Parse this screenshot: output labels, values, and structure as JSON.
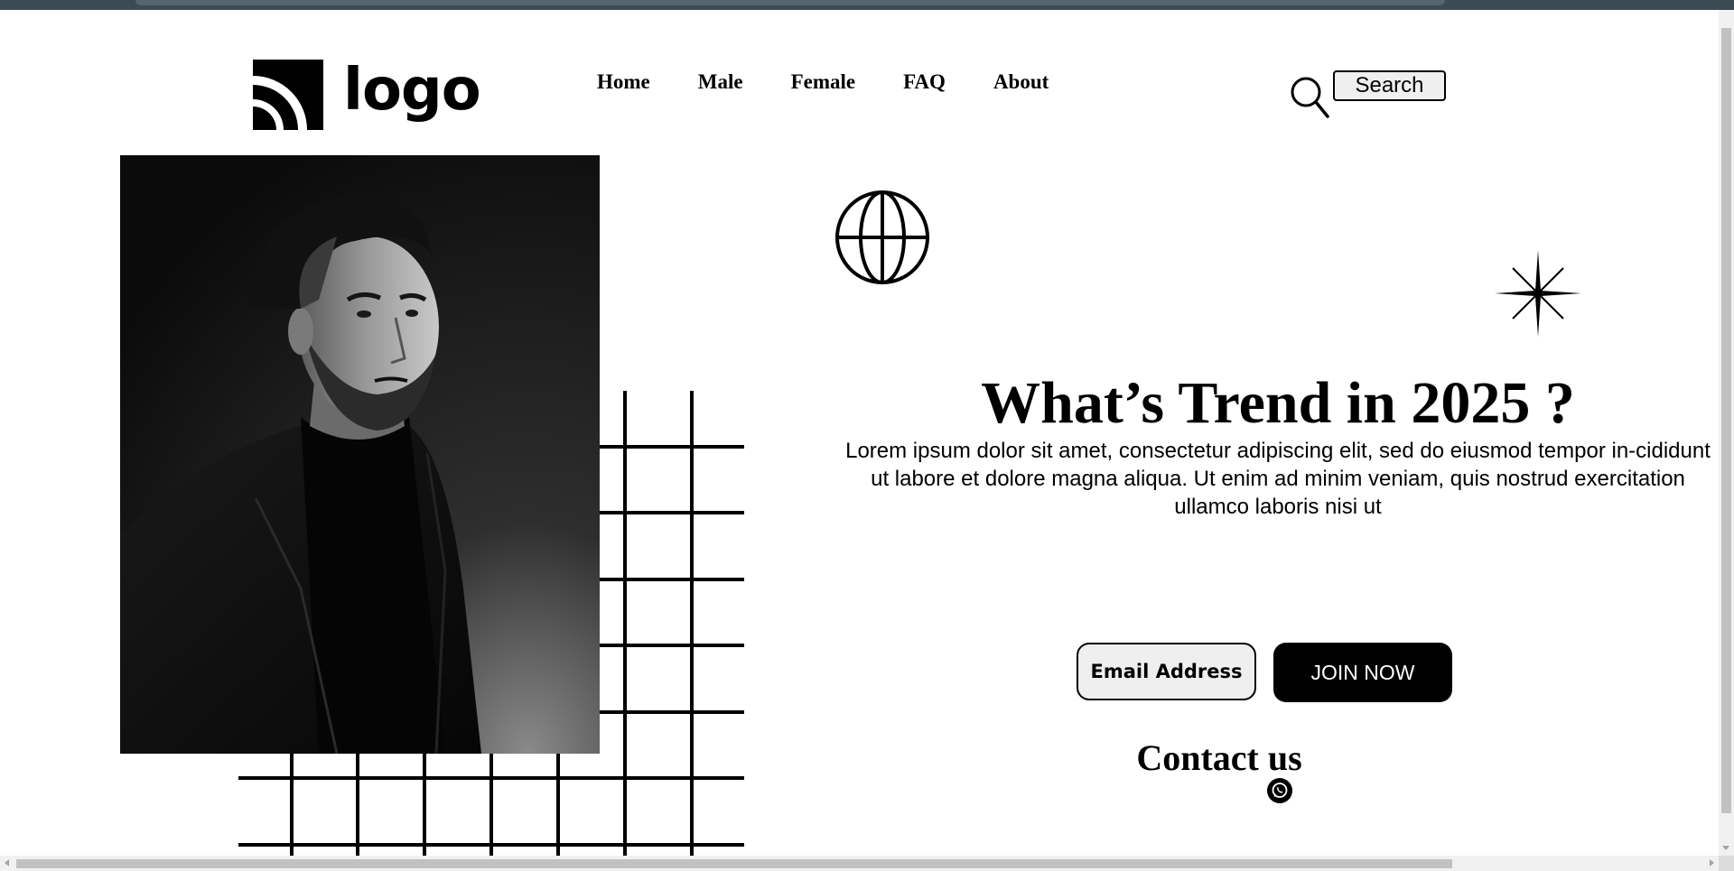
{
  "header": {
    "logo_text": "logo",
    "nav": [
      "Home",
      "Male",
      "Female",
      "FAQ",
      "About"
    ],
    "search_button_label": "Search"
  },
  "hero": {
    "title": "What’s Trend in 2025 ?",
    "body": "Lorem ipsum dolor sit amet, consectetur adipiscing elit, sed do eiusmod tempor in-cididunt ut labore et dolore magna aliqua. Ut enim ad minim veniam, quis nostrud exercitation ullamco laboris nisi ut",
    "photo": "black-and-white portrait of a man in a turtleneck and blazer",
    "decor_icons": [
      "globe-icon",
      "sparkle-icon",
      "grid-pattern"
    ]
  },
  "signup": {
    "email_placeholder": "Email Address",
    "join_label": "JOIN NOW"
  },
  "contact": {
    "title": "Contact us",
    "icon": "whatsapp-icon"
  },
  "colors": {
    "text": "#000000",
    "background": "#ffffff",
    "button_bg": "#000000",
    "input_bg": "#efefef"
  }
}
